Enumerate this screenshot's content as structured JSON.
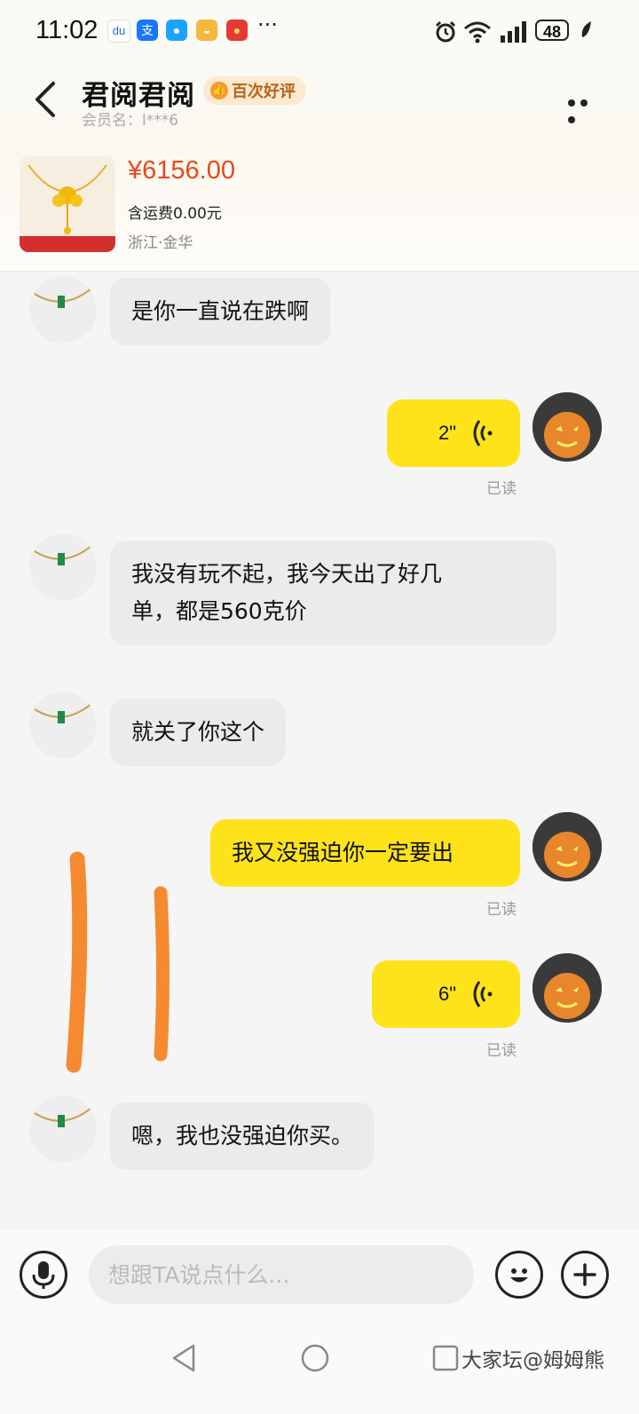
{
  "status_bar": {
    "time": "11:02",
    "apps": [
      "baidu-icon",
      "alipay-icon",
      "message-icon",
      "cup-icon",
      "red-packet-icon"
    ],
    "more": "···",
    "battery": "48"
  },
  "header": {
    "shop_name": "君阅君阅",
    "badge": "百次好评",
    "member_label": "会员名：l***6"
  },
  "product": {
    "price": "¥6156.00",
    "shipping": "含运费0.00元",
    "location": "浙江·金华"
  },
  "messages": [
    {
      "side": "left",
      "text": "是你一直说在跌啊"
    },
    {
      "side": "right",
      "type": "voice",
      "duration": "2\"",
      "status": "已读"
    },
    {
      "side": "left",
      "line1": "我没有玩不起，我今天出了好几",
      "line2": "单，都是560克价"
    },
    {
      "side": "left",
      "text": "就关了你这个"
    },
    {
      "side": "right",
      "text": "我又没强迫你一定要出",
      "status": "已读"
    },
    {
      "side": "right",
      "type": "voice",
      "duration": "6\"",
      "status": "已读"
    },
    {
      "side": "left",
      "text": "嗯，我也没强迫你买。"
    }
  ],
  "composer": {
    "placeholder": "想跟TA说点什么..."
  },
  "watermark": "大家坛@姆姆熊",
  "colors": {
    "accent_yellow": "#ffe31a",
    "price_red": "#e64a19",
    "annotation_orange": "#f58a30"
  }
}
